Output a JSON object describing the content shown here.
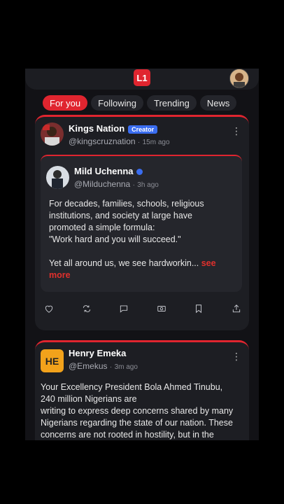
{
  "header": {
    "logo_text": "L1"
  },
  "tabs": [
    {
      "label": "For you",
      "active": true
    },
    {
      "label": "Following"
    },
    {
      "label": "Trending"
    },
    {
      "label": "News"
    }
  ],
  "post1": {
    "author": "Kings Nation",
    "badge": "Creator",
    "handle": "@kingscruznation",
    "time": "15m ago",
    "quoted": {
      "author": "Mild Uchenna",
      "handle": "@Milduchenna",
      "time": "3h ago",
      "text_lines": [
        "For decades, families, schools, religious",
        "institutions, and society at large have",
        "promoted a simple formula:",
        "\"Work hard and you will succeed.\"",
        "",
        "Yet all around us, we see hardworkin..."
      ],
      "see_more_1": "see",
      "see_more_2": "more"
    }
  },
  "post2": {
    "initials": "HE",
    "author": "Henry Emeka",
    "handle": "@Emekus",
    "time": "3m ago",
    "text_lines": [
      "Your Excellency President Bola Ahmed Tinubu,",
      "240 million Nigerians are",
      "writing to express deep concerns shared by many",
      "Nigerians regarding the state of our nation. These",
      "concerns are not rooted in hostility, but in the"
    ]
  },
  "colors": {
    "accent": "#e0252f",
    "background": "#121216",
    "card": "#1d1e23"
  },
  "icons": [
    "like-icon",
    "repost-icon",
    "comment-icon",
    "tip-icon",
    "bookmark-icon",
    "share-icon"
  ]
}
